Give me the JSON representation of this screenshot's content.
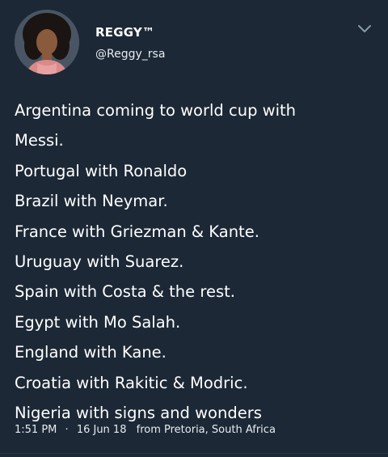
{
  "header": {
    "display_name": "REGGY™",
    "handle": "@Reggy_rsa",
    "avatar_icon": "profile-photo",
    "menu_icon": "chevron-down-icon"
  },
  "tweet": {
    "lines": [
      "Argentina coming to world cup with",
      "Messi.",
      "Portugal with Ronaldo",
      "Brazil with Neymar.",
      "France with Griezman & Kante.",
      "Uruguay with Suarez.",
      "Spain with Costa & the rest.",
      "Egypt with Mo Salah.",
      "England with Kane.",
      "Croatia with Rakitic & Modric.",
      "Nigeria with signs and wonders"
    ]
  },
  "meta": {
    "time": "1:51 PM",
    "separator": "·",
    "date": "16 Jun 18",
    "location": "from Pretoria, South Africa"
  },
  "colors": {
    "background": "#1c2836",
    "text": "#ffffff",
    "secondary_text": "#e6ecf0",
    "icon": "#8899a6"
  }
}
